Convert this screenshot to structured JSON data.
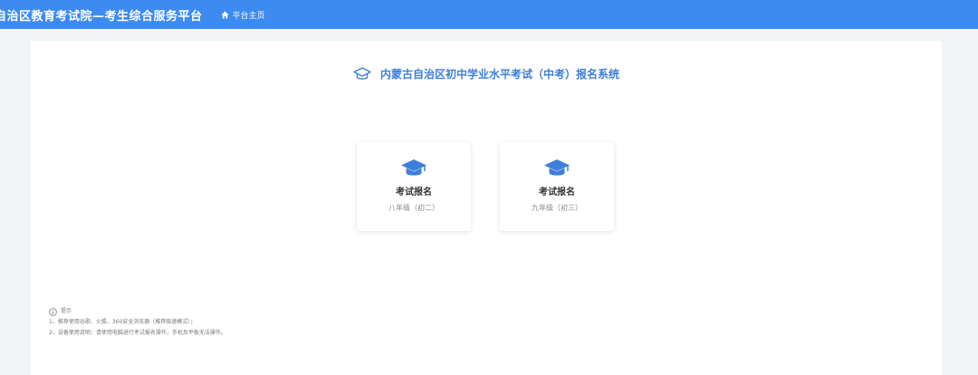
{
  "header": {
    "brand": "自治区教育考试院—考生综合服务平台",
    "home_label": "平台主页"
  },
  "main": {
    "system_title": "内蒙古自治区初中学业水平考试（中考）报名系统",
    "cards": [
      {
        "name": "考试报名",
        "grade": "八年级（初二）"
      },
      {
        "name": "考试报名",
        "grade": "九年级（初三）"
      }
    ]
  },
  "tips": {
    "heading": "提示",
    "lines": [
      "1、推荐使用谷歌、火狐、360安全浏览器（推荐极速模式）；",
      "2、设备使用说明：请使用电脑进行考试报名操作，手机及平板无法操作。"
    ]
  },
  "colors": {
    "primary": "#3d8af0",
    "title_blue": "#3d7fd9",
    "background": "#f2f4f7"
  },
  "icons": [
    "home-icon",
    "graduation-cap-icon",
    "info-icon"
  ]
}
